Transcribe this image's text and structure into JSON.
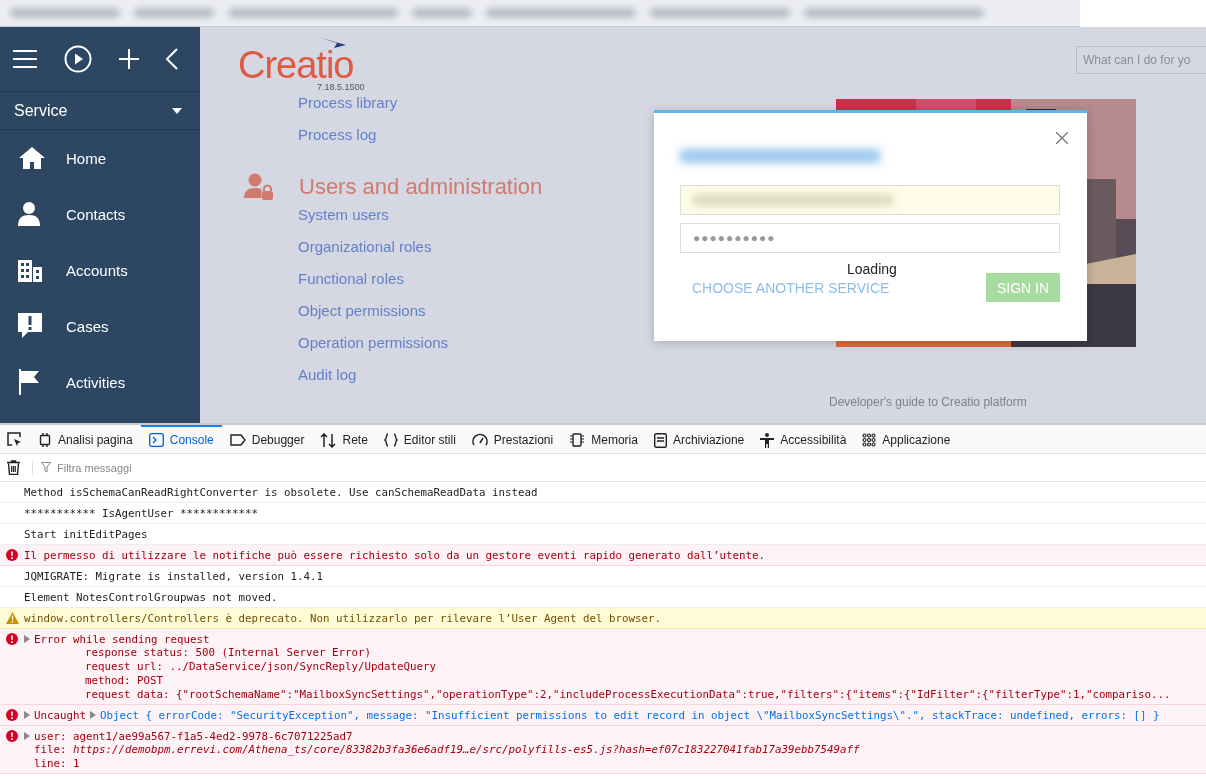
{
  "sidebar": {
    "section": "Service",
    "items": [
      {
        "label": "Home",
        "kind": "home"
      },
      {
        "label": "Contacts",
        "kind": "person"
      },
      {
        "label": "Accounts",
        "kind": "building"
      },
      {
        "label": "Cases",
        "kind": "case"
      },
      {
        "label": "Activities",
        "kind": "flag"
      }
    ]
  },
  "main": {
    "logo": "Creatio",
    "version": "7.18.5.1500",
    "links_top": [
      "Process library",
      "Process log"
    ],
    "section": {
      "title": "Users and administration",
      "links": [
        "System users",
        "Organizational roles",
        "Functional roles",
        "Object permissions",
        "Operation permissions",
        "Audit log"
      ]
    },
    "search": {
      "placeholder": "What can I do for yo"
    },
    "guide_link": "Developer's guide to Creatio platform"
  },
  "login_dialog": {
    "password": "●●●●●●●●●●",
    "link": "CHOOSE ANOTHER SERVICE",
    "loading": "Loading",
    "button": "SIGN IN"
  },
  "devtools": {
    "tabs": [
      {
        "label": "Analisi pagina",
        "kind": "inspector",
        "selected": false
      },
      {
        "label": "Console",
        "kind": "console",
        "selected": true
      },
      {
        "label": "Debugger",
        "kind": "debugger",
        "selected": false
      },
      {
        "label": "Rete",
        "kind": "network",
        "selected": false
      },
      {
        "label": "Editor stili",
        "kind": "style",
        "selected": false
      },
      {
        "label": "Prestazioni",
        "kind": "performance",
        "selected": false
      },
      {
        "label": "Memoria",
        "kind": "memory",
        "selected": false
      },
      {
        "label": "Archiviazione",
        "kind": "storage",
        "selected": false
      },
      {
        "label": "Accessibilità",
        "kind": "accessibility",
        "selected": false
      },
      {
        "label": "Applicazione",
        "kind": "application",
        "selected": false
      }
    ],
    "filter": {
      "placeholder": "Filtra messaggi"
    },
    "messages": [
      {
        "kind": "log",
        "text": "Method isSchemaCanReadRightConverter is obsolete. Use canSchemaReadData instead"
      },
      {
        "kind": "log",
        "text": "*********** IsAgentUser ************"
      },
      {
        "kind": "log",
        "text": "Start initEditPages"
      },
      {
        "kind": "error",
        "text": "Il permesso di utilizzare le notifiche può essere richiesto solo da un gestore eventi rapido generato dall’utente."
      },
      {
        "kind": "log",
        "text": "JQMIGRATE: Migrate is installed, version 1.4.1"
      },
      {
        "kind": "log",
        "text": "Element NotesControlGroupwas not moved."
      },
      {
        "kind": "warning",
        "text": "window.controllers/Controllers è deprecato. Non utilizzarlo per rilevare l’User Agent del browser."
      },
      {
        "kind": "error",
        "expanded": false,
        "text": "Error while sending request",
        "details": [
          {
            "kind": "indented",
            "label": "response status:",
            "value": "500 (Internal Server Error)"
          },
          {
            "kind": "indented",
            "label": "request url:",
            "value": "../DataService/json/SyncReply/UpdateQuery"
          },
          {
            "kind": "indented",
            "label": "method:",
            "value": "POST"
          },
          {
            "kind": "indented",
            "label": "request data:",
            "value": "{\"rootSchemaName\":\"MailboxSyncSettings\",\"operationType\":2,\"includeProcessExecutionData\":true,\"filters\":{\"items\":{\"IdFilter\":{\"filterType\":1,\"compariso..."
          }
        ]
      },
      {
        "kind": "error",
        "expanded": false,
        "prefix": "Uncaught",
        "object_expanded": false,
        "text": "Object { errorCode: \"SecurityException\", message: \"Insufficient permissions to edit record in object \\\"MailboxSyncSettings\\\".\", stackTrace: undefined, errors: [] }"
      },
      {
        "kind": "error",
        "expanded": false,
        "text": "user: agent1/ae99a567-f1a5-4ed2-9978-6c7071225ad7",
        "details": [
          {
            "kind": "source",
            "label": "file:",
            "value": "https://demobpm.errevi.com/Athena_ts/core/83382b3fa36e6adf19…e/src/polyfills-es5.js?hash=ef07c183227041fab17a39ebb7549aff"
          },
          {
            "kind": "short",
            "label": "line:",
            "value": "1"
          }
        ]
      }
    ]
  }
}
